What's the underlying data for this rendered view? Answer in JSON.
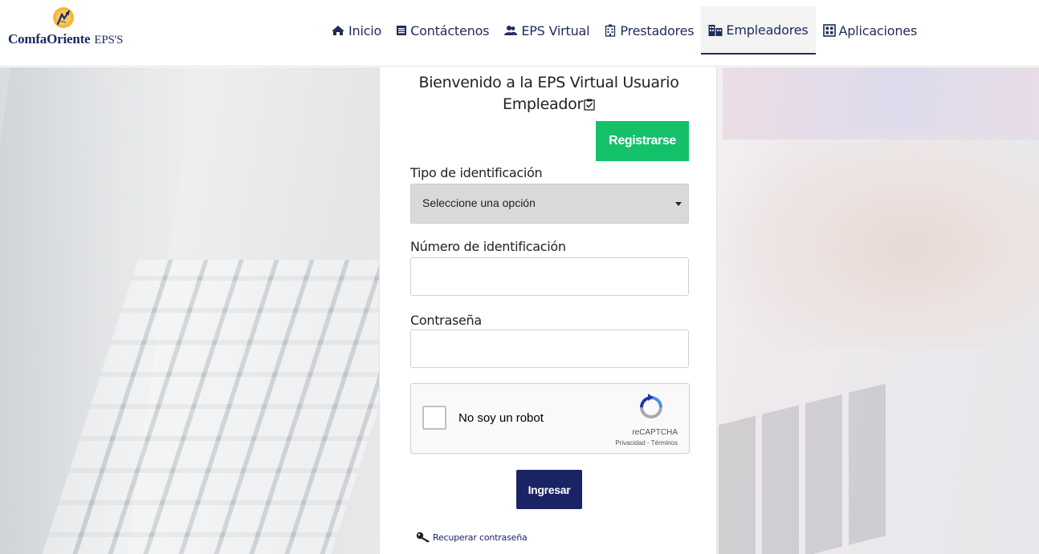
{
  "brand": {
    "name": "ComfaOriente",
    "suffix": "EPS'S",
    "color": "#1a2a66"
  },
  "nav": {
    "items": [
      {
        "label": "Inicio",
        "icon": "home-icon"
      },
      {
        "label": "Contáctenos",
        "icon": "contact-list-icon"
      },
      {
        "label": "EPS Virtual",
        "icon": "users-icon"
      },
      {
        "label": "Prestadores",
        "icon": "clinic-building-icon"
      },
      {
        "label": "Empleadores",
        "icon": "buildings-icon",
        "active": true
      },
      {
        "label": "Aplicaciones",
        "icon": "apps-grid-icon"
      }
    ]
  },
  "form": {
    "title_line1": "Bienvenido a la EPS Virtual Usuario",
    "title_line2": "Empleador",
    "register_label": "Registrarse",
    "id_type_label": "Tipo de identificación",
    "id_type_selected": "Seleccione una opción",
    "id_number_label": "Número de identificación",
    "id_number_value": "",
    "password_label": "Contraseña",
    "password_value": "",
    "login_label": "Ingresar",
    "recover_label": "Recuperar contraseña"
  },
  "captcha": {
    "label": "No soy un robot",
    "brand": "reCAPTCHA",
    "links": "Privacidad - Términos"
  },
  "colors": {
    "primary": "#1a2465",
    "register": "#14c06a",
    "select_bg": "#d9d9d9"
  }
}
